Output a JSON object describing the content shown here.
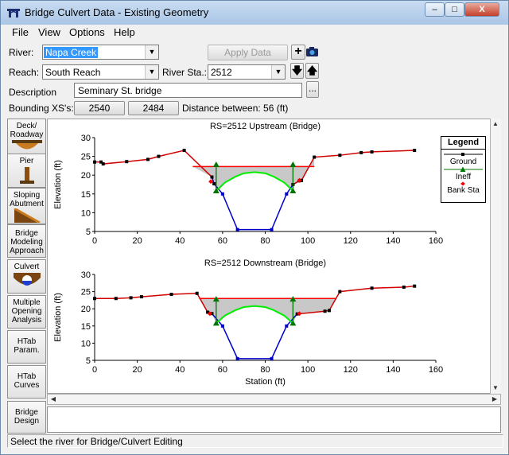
{
  "window": {
    "title": "Bridge Culvert Data - Existing Geometry",
    "minimize_label": "–",
    "maximize_label": "□",
    "close_label": "X"
  },
  "menu": [
    "File",
    "View",
    "Options",
    "Help"
  ],
  "form": {
    "river_label": "River:",
    "river_value": "Napa Creek",
    "apply_data_label": "Apply Data",
    "reach_label": "Reach:",
    "reach_value": "South Reach",
    "river_sta_label": "River Sta.:",
    "river_sta_value": "2512",
    "description_label": "Description",
    "description_value": "Seminary St. bridge",
    "browse_label": "...",
    "bounding_label": "Bounding XS's:",
    "bounding_upstream": "2540",
    "bounding_downstream": "2484",
    "distance_label": "Distance between: 56 (ft)"
  },
  "left_buttons": [
    {
      "label": "Deck/ Roadway",
      "icon": "deck-roadway-icon"
    },
    {
      "label": "Pier",
      "icon": "pier-icon"
    },
    {
      "label": "Sloping Abutment",
      "icon": "sloping-abutment-icon"
    },
    {
      "label": "Bridge Modeling Approach",
      "icon": ""
    },
    {
      "label": "Culvert",
      "icon": "culvert-icon"
    },
    {
      "label": "Multiple Opening Analysis",
      "icon": ""
    },
    {
      "label": "HTab Param.",
      "icon": ""
    },
    {
      "label": "HTab Curves",
      "icon": ""
    },
    {
      "label": "Bridge Design",
      "icon": ""
    }
  ],
  "legend": {
    "title": "Legend",
    "items": [
      {
        "label": "Ground",
        "color": "#ff0000"
      },
      {
        "label": "Ineff",
        "color": "#00aa00"
      },
      {
        "label": "Bank Sta",
        "color": "#ff0000"
      }
    ]
  },
  "status_text": "Select the river for Bridge/Culvert Editing",
  "colors": {
    "ground": "#d00000",
    "deck": "#ff0000",
    "bridge_opening": "#0000cc",
    "arch": "#00ee00",
    "ineff": "#007700",
    "fill": "#c8c8c8"
  },
  "chart_data": [
    {
      "type": "line",
      "title": "RS=2512    Upstream  (Bridge)",
      "xlabel": "",
      "ylabel": "Elevation (ft)",
      "xlim": [
        0,
        160
      ],
      "ylim": [
        5,
        30
      ],
      "x_ticks": [
        0,
        20,
        40,
        60,
        80,
        100,
        120,
        140,
        160
      ],
      "y_ticks": [
        5,
        10,
        15,
        20,
        25,
        30
      ],
      "series": [
        {
          "name": "Ground",
          "x": [
            0,
            3,
            4,
            15,
            25,
            30,
            42,
            55,
            56,
            60,
            67,
            83,
            90,
            93,
            96,
            97,
            103,
            115,
            125,
            130,
            150
          ],
          "y": [
            23.5,
            23.5,
            23,
            23.6,
            24.2,
            25,
            26.6,
            19.5,
            17.7,
            15,
            5.5,
            5.5,
            15,
            17.5,
            18.5,
            18.6,
            24.8,
            25.3,
            26,
            26.2,
            26.6
          ]
        },
        {
          "name": "Ineff",
          "x": [
            57,
            57,
            93,
            93
          ],
          "y": [
            15.8,
            22.8,
            22.8,
            15.8
          ]
        },
        {
          "name": "Bank Sta",
          "x": [
            54.5,
            96
          ],
          "y": [
            18.3,
            18.6
          ]
        }
      ],
      "deck": {
        "x": [
          46,
          103
        ],
        "y": [
          22.3,
          22.3
        ]
      },
      "arch": {
        "x": [
          57,
          61,
          66,
          70,
          75,
          80,
          84,
          89,
          93
        ],
        "y": [
          15.8,
          18.0,
          19.6,
          20.5,
          20.8,
          20.5,
          19.6,
          18.0,
          15.8
        ]
      }
    },
    {
      "type": "line",
      "title": "RS=2512    Downstream  (Bridge)",
      "xlabel": "Station (ft)",
      "ylabel": "Elevation (ft)",
      "xlim": [
        0,
        160
      ],
      "ylim": [
        5,
        30
      ],
      "x_ticks": [
        0,
        20,
        40,
        60,
        80,
        100,
        120,
        140,
        160
      ],
      "y_ticks": [
        5,
        10,
        15,
        20,
        25,
        30
      ],
      "series": [
        {
          "name": "Ground",
          "x": [
            0,
            10,
            17,
            22,
            36,
            48,
            53,
            55,
            60,
            67,
            83,
            90,
            95,
            108,
            110,
            115,
            130,
            145,
            150
          ],
          "y": [
            23,
            23,
            23.2,
            23.5,
            24.2,
            24.5,
            19,
            18.6,
            15,
            5.5,
            5.5,
            15,
            18.5,
            19.3,
            19.5,
            25,
            26,
            26.3,
            26.6
          ]
        },
        {
          "name": "Ineff",
          "x": [
            57,
            57,
            93,
            93
          ],
          "y": [
            15.8,
            22.8,
            22.8,
            15.8
          ]
        },
        {
          "name": "Bank Sta",
          "x": [
            54,
            96
          ],
          "y": [
            18.6,
            18.6
          ]
        }
      ],
      "deck": {
        "x": [
          49,
          113
        ],
        "y": [
          23,
          23
        ]
      },
      "arch": {
        "x": [
          57,
          61,
          66,
          70,
          75,
          80,
          84,
          89,
          93
        ],
        "y": [
          15.8,
          18.0,
          19.6,
          20.5,
          20.8,
          20.5,
          19.6,
          18.0,
          15.8
        ]
      }
    }
  ]
}
